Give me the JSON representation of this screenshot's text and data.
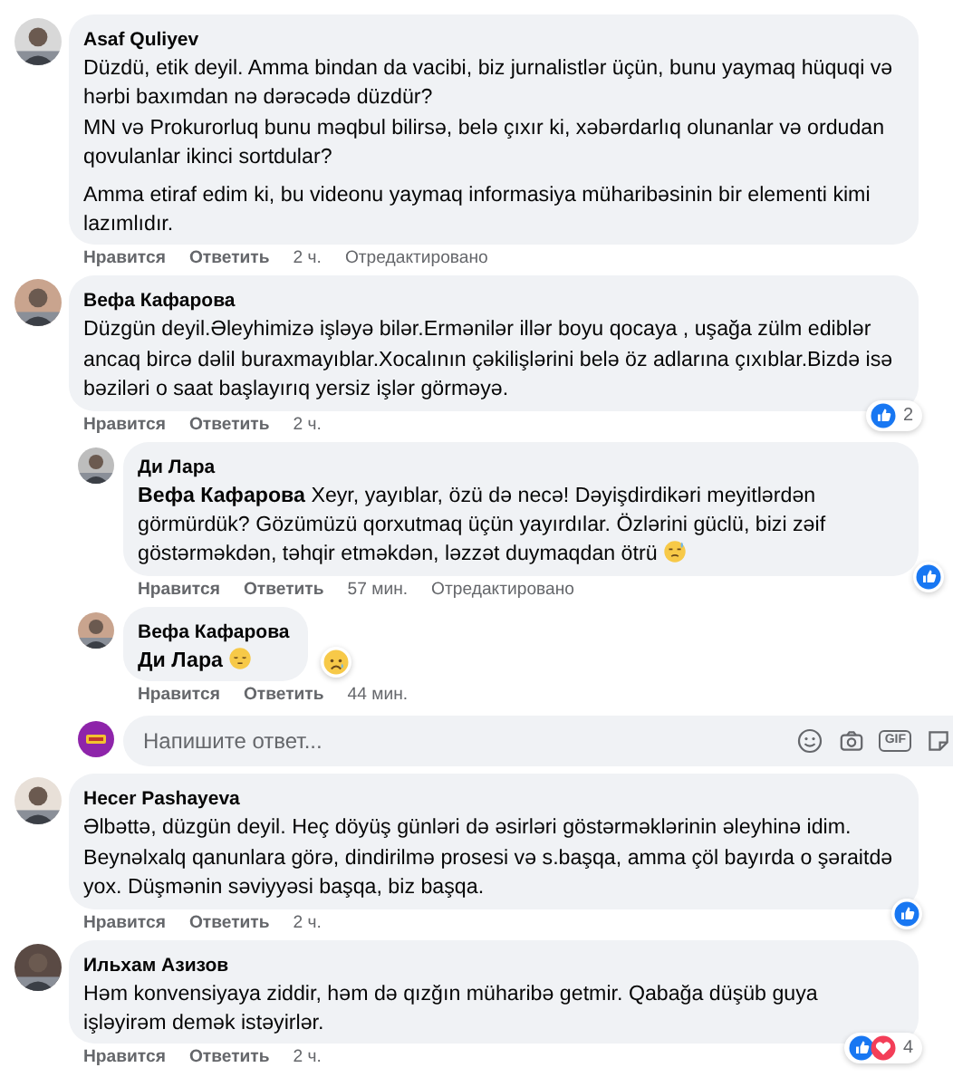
{
  "comments": [
    {
      "author": "Asaf Quliyev",
      "avatar": {
        "kind": "picture"
      },
      "paragraphs": [
        "Düzdü, etik deyil. Amma bindan da vacibi, biz jurnalistlər üçün, bunu yaymaq hüquqi və hərbi baxımdan nə dərəcədə düzdür?\nMN və Prokurorluq bunu məqbul bilirsə, belə çıxır ki, xəbərdarlıq olunanlar və ordudan qovulanlar ikinci sortdular?",
        "Amma etiraf edim ki, bu videonu yaymaq informasiya müharibəsinin bir elementi kimi lazımlıdır."
      ],
      "like_label": "Нравится",
      "reply_label": "Ответить",
      "time": "2 ч.",
      "edited": "Отредактировано"
    },
    {
      "author": "Вефа Кафарова",
      "avatar": {
        "kind": "picture"
      },
      "paragraphs": [
        "Düzgün deyil.Əleyhimizə işləyə bilər.Ermənilər illər boyu qocaya , uşağa zülm ediblər ancaq bircə dəlil buraxmayıblar.Xocalının çəkilişlərini belə öz adlarına çıxıblar.Bizdə isə bəziləri o saat başlayırıq yersiz işlər görməyə."
      ],
      "like_label": "Нравится",
      "reply_label": "Ответить",
      "time": "2 ч.",
      "reactions": {
        "items": [
          {
            "kind": "like"
          }
        ],
        "count": "2"
      },
      "replies": [
        {
          "author": "Ди Лара",
          "avatar": {
            "kind": "picture"
          },
          "paragraphs": [
            "**Вефа Кафарова** Xeyr, yayıblar, özü də necə! Dəyişdirdikəri meyitlərdən görmürdük? Gözümüzü qorxutmaq üçün yayırdılar. Özlərini güclü, bizi zəif göstərməkdən, təhqir etməkdən, ləzzət duymaqdan ötrü"
          ],
          "emoji": {
            "kind": "sweat"
          },
          "like_label": "Нравится",
          "reply_label": "Ответить",
          "time": "57 мин.",
          "edited": "Отредактировано",
          "reactions": {
            "items": [
              {
                "kind": "like"
              }
            ]
          }
        },
        {
          "author": "Вефа Кафарова",
          "avatar": {
            "kind": "picture"
          },
          "paragraphs": [
            "**Ди Лара**"
          ],
          "emoji": {
            "kind": "pensive"
          },
          "like_label": "Нравится",
          "reply_label": "Ответить",
          "time": "44 мин.",
          "reactions": {
            "items": [
              {
                "kind": "sad"
              }
            ]
          }
        }
      ],
      "reply_box": {
        "placeholder": "Напишите ответ...",
        "gif_label": "GIF"
      }
    },
    {
      "author": "Hecer Pashayeva",
      "avatar": {
        "kind": "picture"
      },
      "paragraphs": [
        "Əlbəttə, düzgün deyil. Heç döyüş günləri də əsirləri göstərməklərinin əleyhinə idim. Beynəlxalq qanunlara görə, dindirilmə prosesi və s.başqa, amma çöl bayırda o şəraitdə yox. Düşmənin səviyyəsi başqa, biz başqa."
      ],
      "like_label": "Нравится",
      "reply_label": "Ответить",
      "time": "2 ч.",
      "reactions": {
        "items": [
          {
            "kind": "like"
          }
        ]
      }
    },
    {
      "author": "Ильхам Азизов",
      "avatar": {
        "kind": "picture"
      },
      "paragraphs": [
        "Həm konvensiyaya ziddir, həm də qızğın müharibə getmir. Qabağa düşüb guya işləyirəm demək istəyirlər."
      ],
      "like_label": "Нравится",
      "reply_label": "Ответить",
      "time": "2 ч.",
      "reactions": {
        "items": [
          {
            "kind": "like"
          },
          {
            "kind": "love"
          }
        ],
        "count": "4"
      }
    }
  ]
}
